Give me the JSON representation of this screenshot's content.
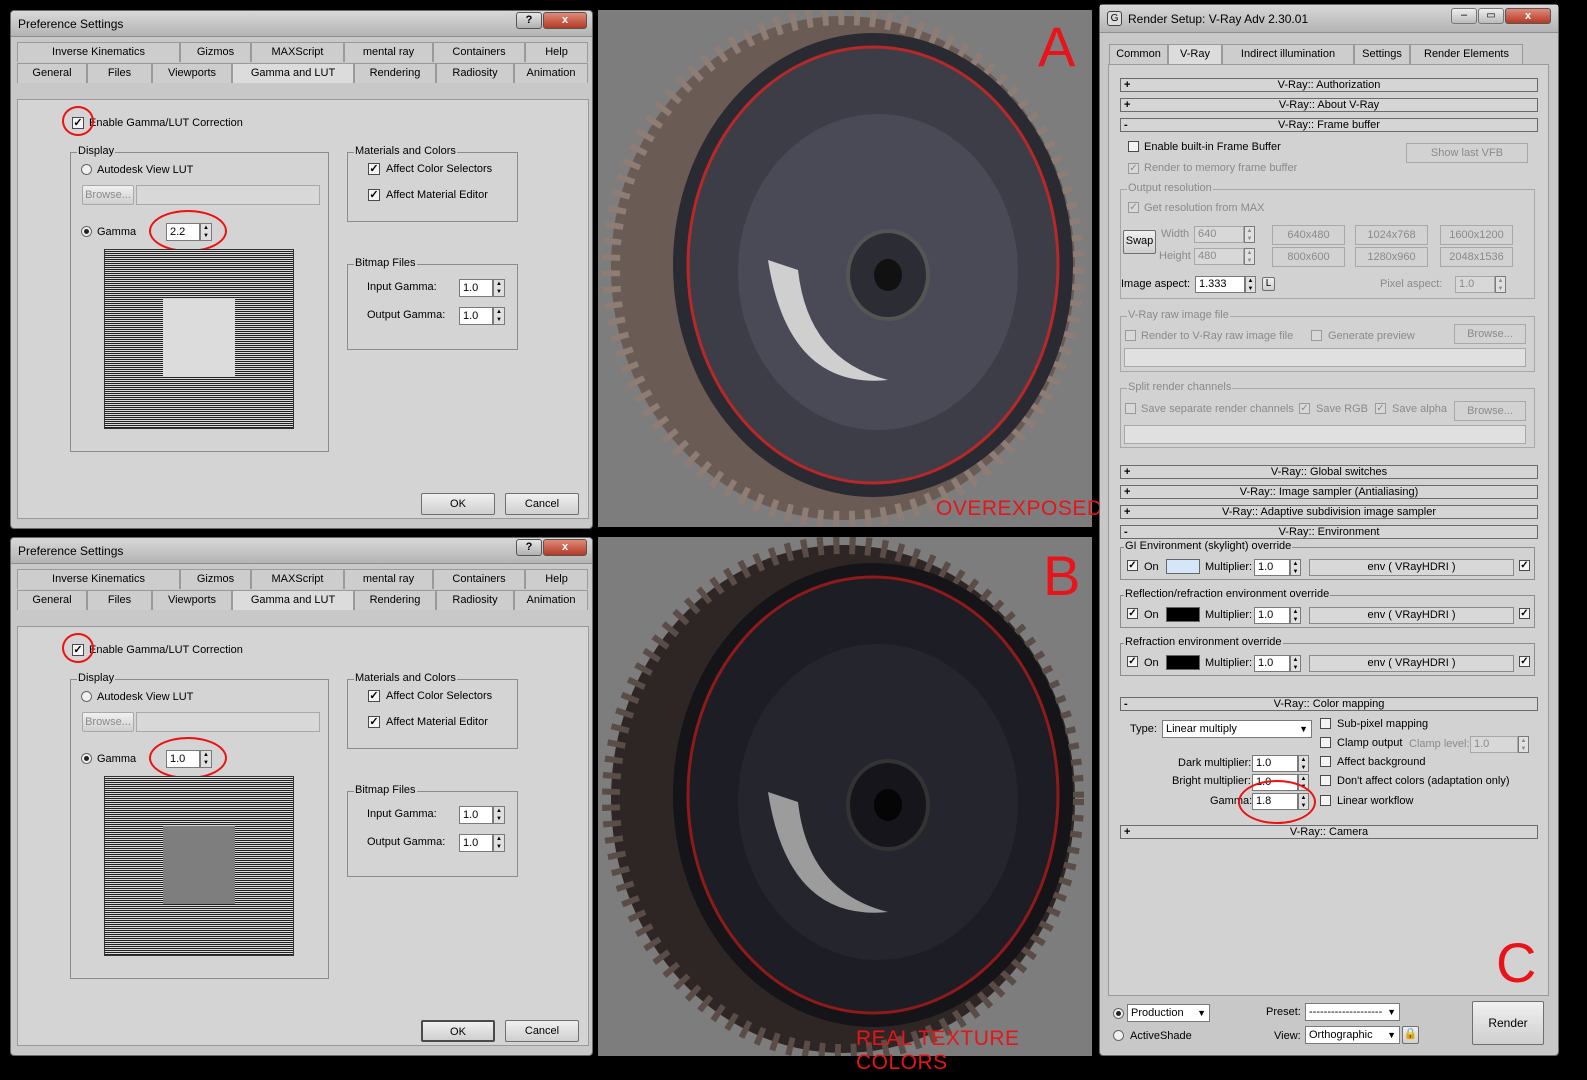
{
  "panel_a": {
    "title": "Preference Settings",
    "tabs_row1": [
      "Inverse Kinematics",
      "Gizmos",
      "MAXScript",
      "mental ray",
      "Containers",
      "Help"
    ],
    "tabs_row2": [
      "General",
      "Files",
      "Viewports",
      "Gamma and LUT",
      "Rendering",
      "Radiosity",
      "Animation"
    ],
    "enable_label": "Enable Gamma/LUT Correction",
    "display_group": "Display",
    "autodesk_lut": "Autodesk View LUT",
    "browse": "Browse...",
    "gamma_label": "Gamma",
    "gamma_value": "2.2",
    "materials_group": "Materials and Colors",
    "affect_color_selectors": "Affect Color Selectors",
    "affect_material_editor": "Affect Material Editor",
    "bitmap_group": "Bitmap Files",
    "input_gamma_label": "Input Gamma:",
    "input_gamma": "1.0",
    "output_gamma_label": "Output Gamma:",
    "output_gamma": "1.0",
    "ok": "OK",
    "cancel": "Cancel",
    "help_glyph": "?",
    "close_glyph": "x"
  },
  "panel_b": {
    "title": "Preference Settings",
    "gamma_value": "1.0",
    "input_gamma": "1.0",
    "output_gamma": "1.0"
  },
  "viewport_a": {
    "letter": "A",
    "caption": "OVEREXPOSED"
  },
  "viewport_b": {
    "letter": "B",
    "caption": "REAL TEXTURE COLORS"
  },
  "render_setup": {
    "title": "Render Setup: V-Ray Adv 2.30.01",
    "letter": "C",
    "tabs": [
      "Common",
      "V-Ray",
      "Indirect illumination",
      "Settings",
      "Render Elements"
    ],
    "rollouts": {
      "authorization": "V-Ray:: Authorization",
      "about": "V-Ray:: About V-Ray",
      "frame_buffer": "V-Ray:: Frame buffer",
      "global_switches": "V-Ray:: Global switches",
      "image_sampler": "V-Ray:: Image sampler (Antialiasing)",
      "adaptive": "V-Ray:: Adaptive subdivision image sampler",
      "environment": "V-Ray:: Environment",
      "color_mapping": "V-Ray:: Color mapping",
      "camera": "V-Ray:: Camera"
    },
    "fb": {
      "enable_builtin": "Enable built-in Frame Buffer",
      "render_to_memory": "Render to memory frame buffer",
      "show_last_vfb": "Show last VFB",
      "output_resolution": "Output resolution",
      "get_resolution": "Get resolution from MAX",
      "swap": "Swap",
      "width_label": "Width",
      "width": "640",
      "height_label": "Height",
      "height": "480",
      "presets": [
        "640x480",
        "1024x768",
        "1600x1200",
        "800x600",
        "1280x960",
        "2048x1536"
      ],
      "image_aspect_label": "Image aspect:",
      "image_aspect": "1.333",
      "lock": "L",
      "pixel_aspect_label": "Pixel aspect:",
      "pixel_aspect": "1.0",
      "raw_group": "V-Ray raw image file",
      "render_raw": "Render to V-Ray raw image file",
      "generate_preview": "Generate preview",
      "browse": "Browse...",
      "split_group": "Split render channels",
      "save_separate": "Save separate render channels",
      "save_rgb": "Save RGB",
      "save_alpha": "Save alpha"
    },
    "env": {
      "gi_group": "GI Environment (skylight) override",
      "refl_group": "Reflection/refraction environment override",
      "refr_group": "Refraction environment override",
      "on": "On",
      "multiplier_label": "Multiplier:",
      "multiplier": "1.0",
      "map": "env  ( VRayHDRI )",
      "gi_color": "#d4e6f8",
      "refl_color": "#000000",
      "refr_color": "#000000"
    },
    "cm": {
      "type_label": "Type:",
      "type": "Linear multiply",
      "dark_label": "Dark multiplier:",
      "dark": "1.0",
      "bright_label": "Bright multiplier:",
      "bright": "1.0",
      "gamma_label": "Gamma:",
      "gamma": "1.8",
      "subpixel": "Sub-pixel mapping",
      "clamp_output": "Clamp output",
      "clamp_level_label": "Clamp level:",
      "clamp_level": "1.0",
      "affect_bg": "Affect background",
      "dont_affect": "Don't affect colors (adaptation only)",
      "linear_workflow": "Linear workflow"
    },
    "bottom": {
      "production": "Production",
      "activeshade": "ActiveShade",
      "preset_label": "Preset:",
      "preset": "--------------------",
      "view_label": "View:",
      "view": "Orthographic",
      "render": "Render"
    }
  }
}
